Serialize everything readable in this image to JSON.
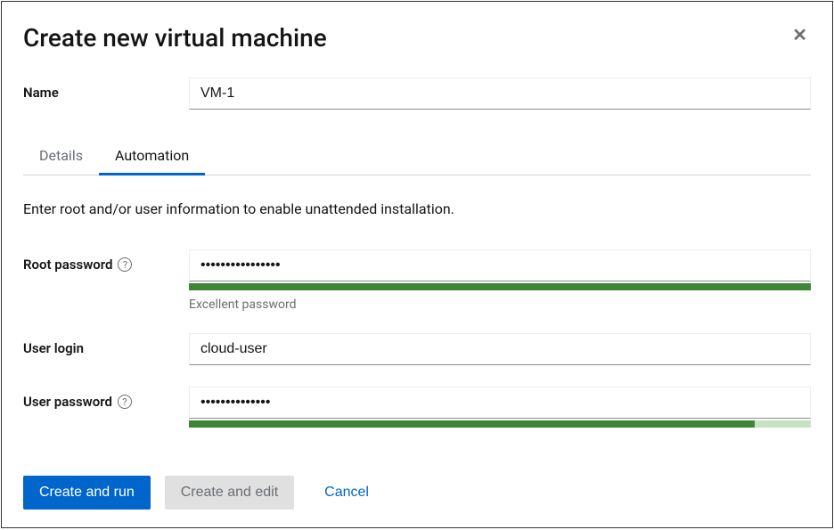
{
  "modal": {
    "title": "Create new virtual machine",
    "name_label": "Name",
    "name_value": "VM-1",
    "tabs": {
      "details": "Details",
      "automation": "Automation"
    },
    "description": "Enter root and/or user information to enable unattended installation.",
    "root_password": {
      "label": "Root password",
      "value": "••••••••••••••••",
      "strength_percent": 100,
      "strength_label": "Excellent password"
    },
    "user_login": {
      "label": "User login",
      "value": "cloud-user"
    },
    "user_password": {
      "label": "User password",
      "value": "••••••••••••••",
      "strength_percent": 91
    },
    "footer": {
      "create_run": "Create and run",
      "create_edit": "Create and edit",
      "cancel": "Cancel"
    }
  }
}
